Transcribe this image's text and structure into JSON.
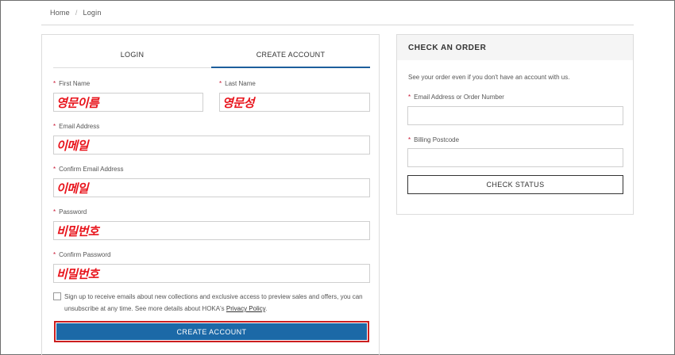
{
  "breadcrumb": {
    "home": "Home",
    "separator": "/",
    "current": "Login"
  },
  "tabs": {
    "login": "LOGIN",
    "create": "CREATE ACCOUNT"
  },
  "form": {
    "required_mark": "*",
    "first_name": {
      "label": "First Name",
      "value": "영문이름"
    },
    "last_name": {
      "label": "Last Name",
      "value": "영문성"
    },
    "email": {
      "label": "Email Address",
      "value": "이메일"
    },
    "confirm_email": {
      "label": "Confirm Email Address",
      "value": "이메일"
    },
    "password": {
      "label": "Password",
      "value": "비밀번호"
    },
    "confirm_password": {
      "label": "Confirm Password",
      "value": "비밀번호"
    },
    "consent_text": "Sign up to receive emails about new collections and exclusive access to preview sales and offers, you can unsubscribe at any time. See more details about HOKA's ",
    "consent_link": "Privacy Policy",
    "consent_end": ".",
    "submit": "CREATE ACCOUNT"
  },
  "check_order": {
    "title": "CHECK AN ORDER",
    "intro": "See your order even if you don't have an account with us.",
    "order_label": "Email Address or Order Number",
    "postcode_label": "Billing Postcode",
    "button": "CHECK STATUS"
  },
  "colors": {
    "accent": "#1c69a7",
    "tab_underline": "#1d5e9c",
    "required": "#c8102e",
    "annotation": "#e8141c",
    "highlight_border": "#cc1f1f"
  }
}
